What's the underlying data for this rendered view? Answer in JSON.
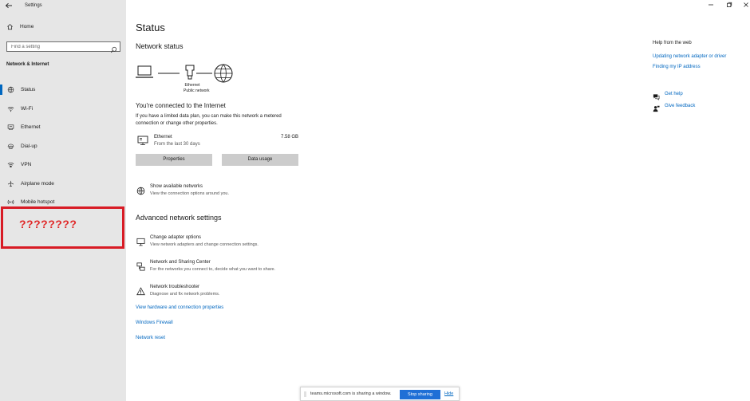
{
  "window": {
    "title": "Settings",
    "back_icon": "back-arrow-icon",
    "controls": [
      "minimize-icon",
      "maximize-icon",
      "close-icon"
    ]
  },
  "sidebar": {
    "home_label": "Home",
    "search_placeholder": "Find a setting",
    "section_title": "Network & Internet",
    "items": [
      {
        "label": "Status",
        "icon": "status-globe-icon",
        "active": true
      },
      {
        "label": "Wi-Fi",
        "icon": "wifi-icon",
        "active": false
      },
      {
        "label": "Ethernet",
        "icon": "ethernet-icon",
        "active": false
      },
      {
        "label": "Dial-up",
        "icon": "dialup-icon",
        "active": false
      },
      {
        "label": "VPN",
        "icon": "vpn-icon",
        "active": false
      },
      {
        "label": "Airplane mode",
        "icon": "airplane-icon",
        "active": false
      },
      {
        "label": "Mobile hotspot",
        "icon": "hotspot-icon",
        "active": false
      }
    ],
    "redacted_text": "????????"
  },
  "main": {
    "page_title": "Status",
    "network_status_title": "Network status",
    "diagram": {
      "adapter_label": "Ethernet",
      "network_label": "Public network"
    },
    "connected_title": "You're connected to the Internet",
    "connected_desc": "If you have a limited data plan, you can make this network a metered connection or change other properties.",
    "ethernet": {
      "name": "Ethernet",
      "period": "From the last 30 days",
      "amount": "7.58 GB"
    },
    "buttons": {
      "properties": "Properties",
      "data_usage": "Data usage"
    },
    "show_networks": {
      "title": "Show available networks",
      "desc": "View the connection options around you."
    },
    "advanced_title": "Advanced network settings",
    "advanced_items": [
      {
        "title": "Change adapter options",
        "desc": "View network adapters and change connection settings."
      },
      {
        "title": "Network and Sharing Center",
        "desc": "For the networks you connect to, decide what you want to share."
      },
      {
        "title": "Network troubleshooter",
        "desc": "Diagnose and fix network problems."
      }
    ],
    "links": {
      "hardware": "View hardware and connection properties",
      "firewall": "Windows Firewall",
      "reset": "Network reset"
    }
  },
  "help": {
    "title": "Help from the web",
    "links": [
      "Updating network adapter or driver",
      "Finding my IP address"
    ],
    "get_help": "Get help",
    "feedback": "Give feedback"
  },
  "share_bar": {
    "message": "teams.microsoft.com is sharing a window.",
    "stop_label": "Stop sharing",
    "hide_label": "Hide",
    "accent": "#1f6fd6"
  },
  "colors": {
    "accent": "#0067c0",
    "sidebar_bg": "#e6e6e6",
    "button_bg": "#cccccc",
    "redact": "#d81b25"
  }
}
